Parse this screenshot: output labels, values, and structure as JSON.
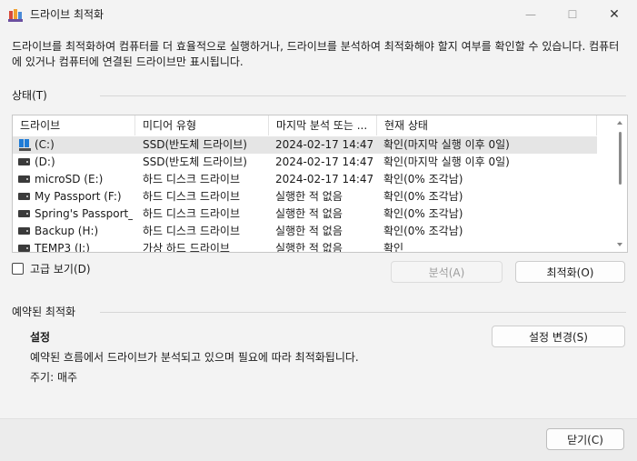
{
  "window": {
    "title": "드라이브 최적화",
    "min_glyph": "—",
    "max_glyph": "☐",
    "close_glyph": "✕"
  },
  "description": "드라이브를 최적화하여 컴퓨터를 더 효율적으로 실행하거나, 드라이브를 분석하여 최적화해야 할지 여부를 확인할 수 있습니다. 컴퓨터에 있거나 컴퓨터에 연결된 드라이브만 표시됩니다.",
  "status_section": {
    "label": "상태(T)"
  },
  "drive_list": {
    "columns": [
      "드라이브",
      "미디어 유형",
      "마지막 분석 또는 ...",
      "현재 상태"
    ],
    "rows": [
      {
        "drive": "(C:)",
        "media": "SSD(반도체 드라이브)",
        "last": "2024-02-17 14:47",
        "status": "확인(마지막 실행 이후 0일)",
        "icon": "windows-drive-icon",
        "selected": true
      },
      {
        "drive": "(D:)",
        "media": "SSD(반도체 드라이브)",
        "last": "2024-02-17 14:47",
        "status": "확인(마지막 실행 이후 0일)",
        "icon": "hard-drive-icon",
        "selected": false
      },
      {
        "drive": "microSD (E:)",
        "media": "하드 디스크 드라이브",
        "last": "2024-02-17 14:47",
        "status": "확인(0% 조각남)",
        "icon": "hard-drive-icon",
        "selected": false
      },
      {
        "drive": "My Passport (F:)",
        "media": "하드 디스크 드라이브",
        "last": "실행한 적 없음",
        "status": "확인(0% 조각남)",
        "icon": "hard-drive-icon",
        "selected": false
      },
      {
        "drive": "Spring's Passport_...",
        "media": "하드 디스크 드라이브",
        "last": "실행한 적 없음",
        "status": "확인(0% 조각남)",
        "icon": "hard-drive-icon",
        "selected": false
      },
      {
        "drive": "Backup (H:)",
        "media": "하드 디스크 드라이브",
        "last": "실행한 적 없음",
        "status": "확인(0% 조각남)",
        "icon": "hard-drive-icon",
        "selected": false
      },
      {
        "drive": "TEMP3 (I:)",
        "media": "가상 하드 드라이브",
        "last": "실행한 적 없음",
        "status": "확인",
        "icon": "hard-drive-icon",
        "selected": false
      }
    ]
  },
  "advanced_view": {
    "label": "고급 보기(D)",
    "checked": false
  },
  "buttons": {
    "analyze": "분석(A)",
    "optimize": "최적화(O)",
    "change_settings": "설정 변경(S)",
    "close": "닫기(C)"
  },
  "scheduled_section": {
    "label": "예약된 최적화",
    "settings_title": "설정",
    "settings_desc": "예약된 흐름에서 드라이브가 분석되고 있으며 필요에 따라 최적화됩니다.",
    "frequency": "주기: 매주"
  }
}
